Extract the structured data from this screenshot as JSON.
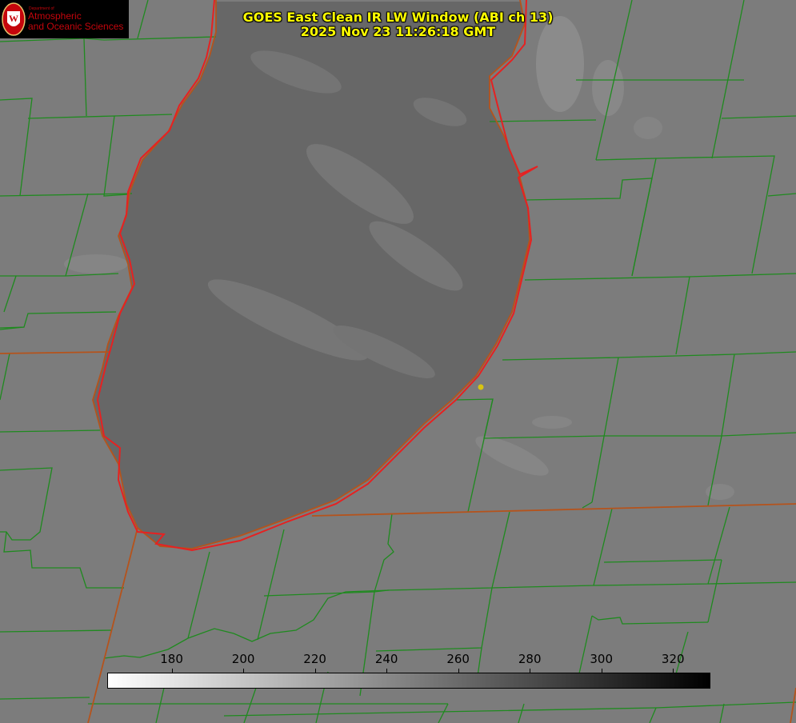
{
  "header": {
    "title_line1": "GOES East Clean IR LW Window (ABI ch 13)",
    "title_line2": "2025 Nov 23 11:26:18 GMT"
  },
  "logo": {
    "department_label": "Department of",
    "name_line1": "Atmospheric",
    "name_line2": "and Oceanic Sciences",
    "seal_letter": "W",
    "colors": {
      "background": "#000000",
      "brand": "#c5050c"
    }
  },
  "colorbar": {
    "ticks": [
      "180",
      "200",
      "220",
      "240",
      "260",
      "280",
      "300",
      "320"
    ],
    "min_value": 162,
    "max_value": 330,
    "tick_values": [
      180,
      200,
      220,
      240,
      260,
      280,
      300,
      320
    ],
    "colormap": "white-to-black grayscale"
  },
  "map": {
    "colors": {
      "county_lines": "#1f8a1f",
      "state_borders": "#b5531c",
      "lake_outline": "#e62121",
      "marker": "#d8c411",
      "land": "#7c7c7c",
      "lake": "#676767"
    }
  }
}
